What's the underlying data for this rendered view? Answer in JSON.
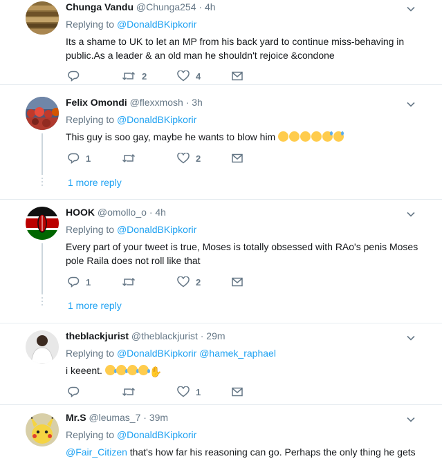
{
  "tweets": [
    {
      "name": "Chunga Vandu",
      "handle": "@Chunga254",
      "time": "4h",
      "replying_label": "Replying to",
      "replying_to": [
        "@DonaldBKipkorir"
      ],
      "text": "Its a shame to UK to let an MP from his back yard to continue miss-behaving in public.As a leader & an old man he shouldn't rejoice &condone",
      "counts": {
        "reply": "",
        "retweet": "2",
        "like": "4"
      },
      "avatar": "stack-of-documents-photo"
    },
    {
      "name": "Felix Omondi",
      "handle": "@flexxmosh",
      "time": "3h",
      "replying_label": "Replying to",
      "replying_to": [
        "@DonaldBKipkorir"
      ],
      "text": "This guy is soo gay, maybe he wants to blow him",
      "emojis": [
        "grinning-squinting-face",
        "grinning-squinting-face",
        "grinning-squinting-face",
        "grinning-squinting-face",
        "grinning-face-with-sweat",
        "grinning-face-with-sweat"
      ],
      "counts": {
        "reply": "1",
        "retweet": "",
        "like": "2"
      },
      "more_replies": "1 more reply",
      "avatar": "crowd-in-red-photo"
    },
    {
      "name": "HOOK",
      "handle": "@omollo_o",
      "time": "4h",
      "replying_label": "Replying to",
      "replying_to": [
        "@DonaldBKipkorir"
      ],
      "text": "Every part of your tweet is true, Moses is totally obsessed with RAo's penis Moses pole Raila does not roll like that",
      "counts": {
        "reply": "1",
        "retweet": "",
        "like": "2"
      },
      "more_replies": "1 more reply",
      "avatar": "kenya-flag-avatar"
    },
    {
      "name": "theblackjurist",
      "handle": "@theblackjurist",
      "time": "29m",
      "replying_label": "Replying to",
      "replying_to": [
        "@DonaldBKipkorir",
        "@hamek_raphael"
      ],
      "text": "i keeent.",
      "emojis": [
        "face-with-tears-of-joy",
        "face-with-tears-of-joy",
        "face-with-tears-of-joy",
        "face-with-tears-of-joy",
        "raising-hands"
      ],
      "counts": {
        "reply": "",
        "retweet": "",
        "like": "1"
      },
      "avatar": "person-in-white-shirt-photo"
    },
    {
      "name": "Mr.S",
      "handle": "@leumas_7",
      "time": "39m",
      "replying_label": "Replying to",
      "replying_to": [
        "@DonaldBKipkorir"
      ],
      "text_mention": "@Fair_Citizen",
      "text": "that's how far his reasoning can go. Perhaps the only thing he gets",
      "avatar": "pikachu-avatar"
    }
  ],
  "separator": "·",
  "colors": {
    "link": "#1da1f2",
    "muted": "#657786",
    "text": "#14171a",
    "border": "#e6ecf0",
    "emoji": "#ffcc4d"
  }
}
